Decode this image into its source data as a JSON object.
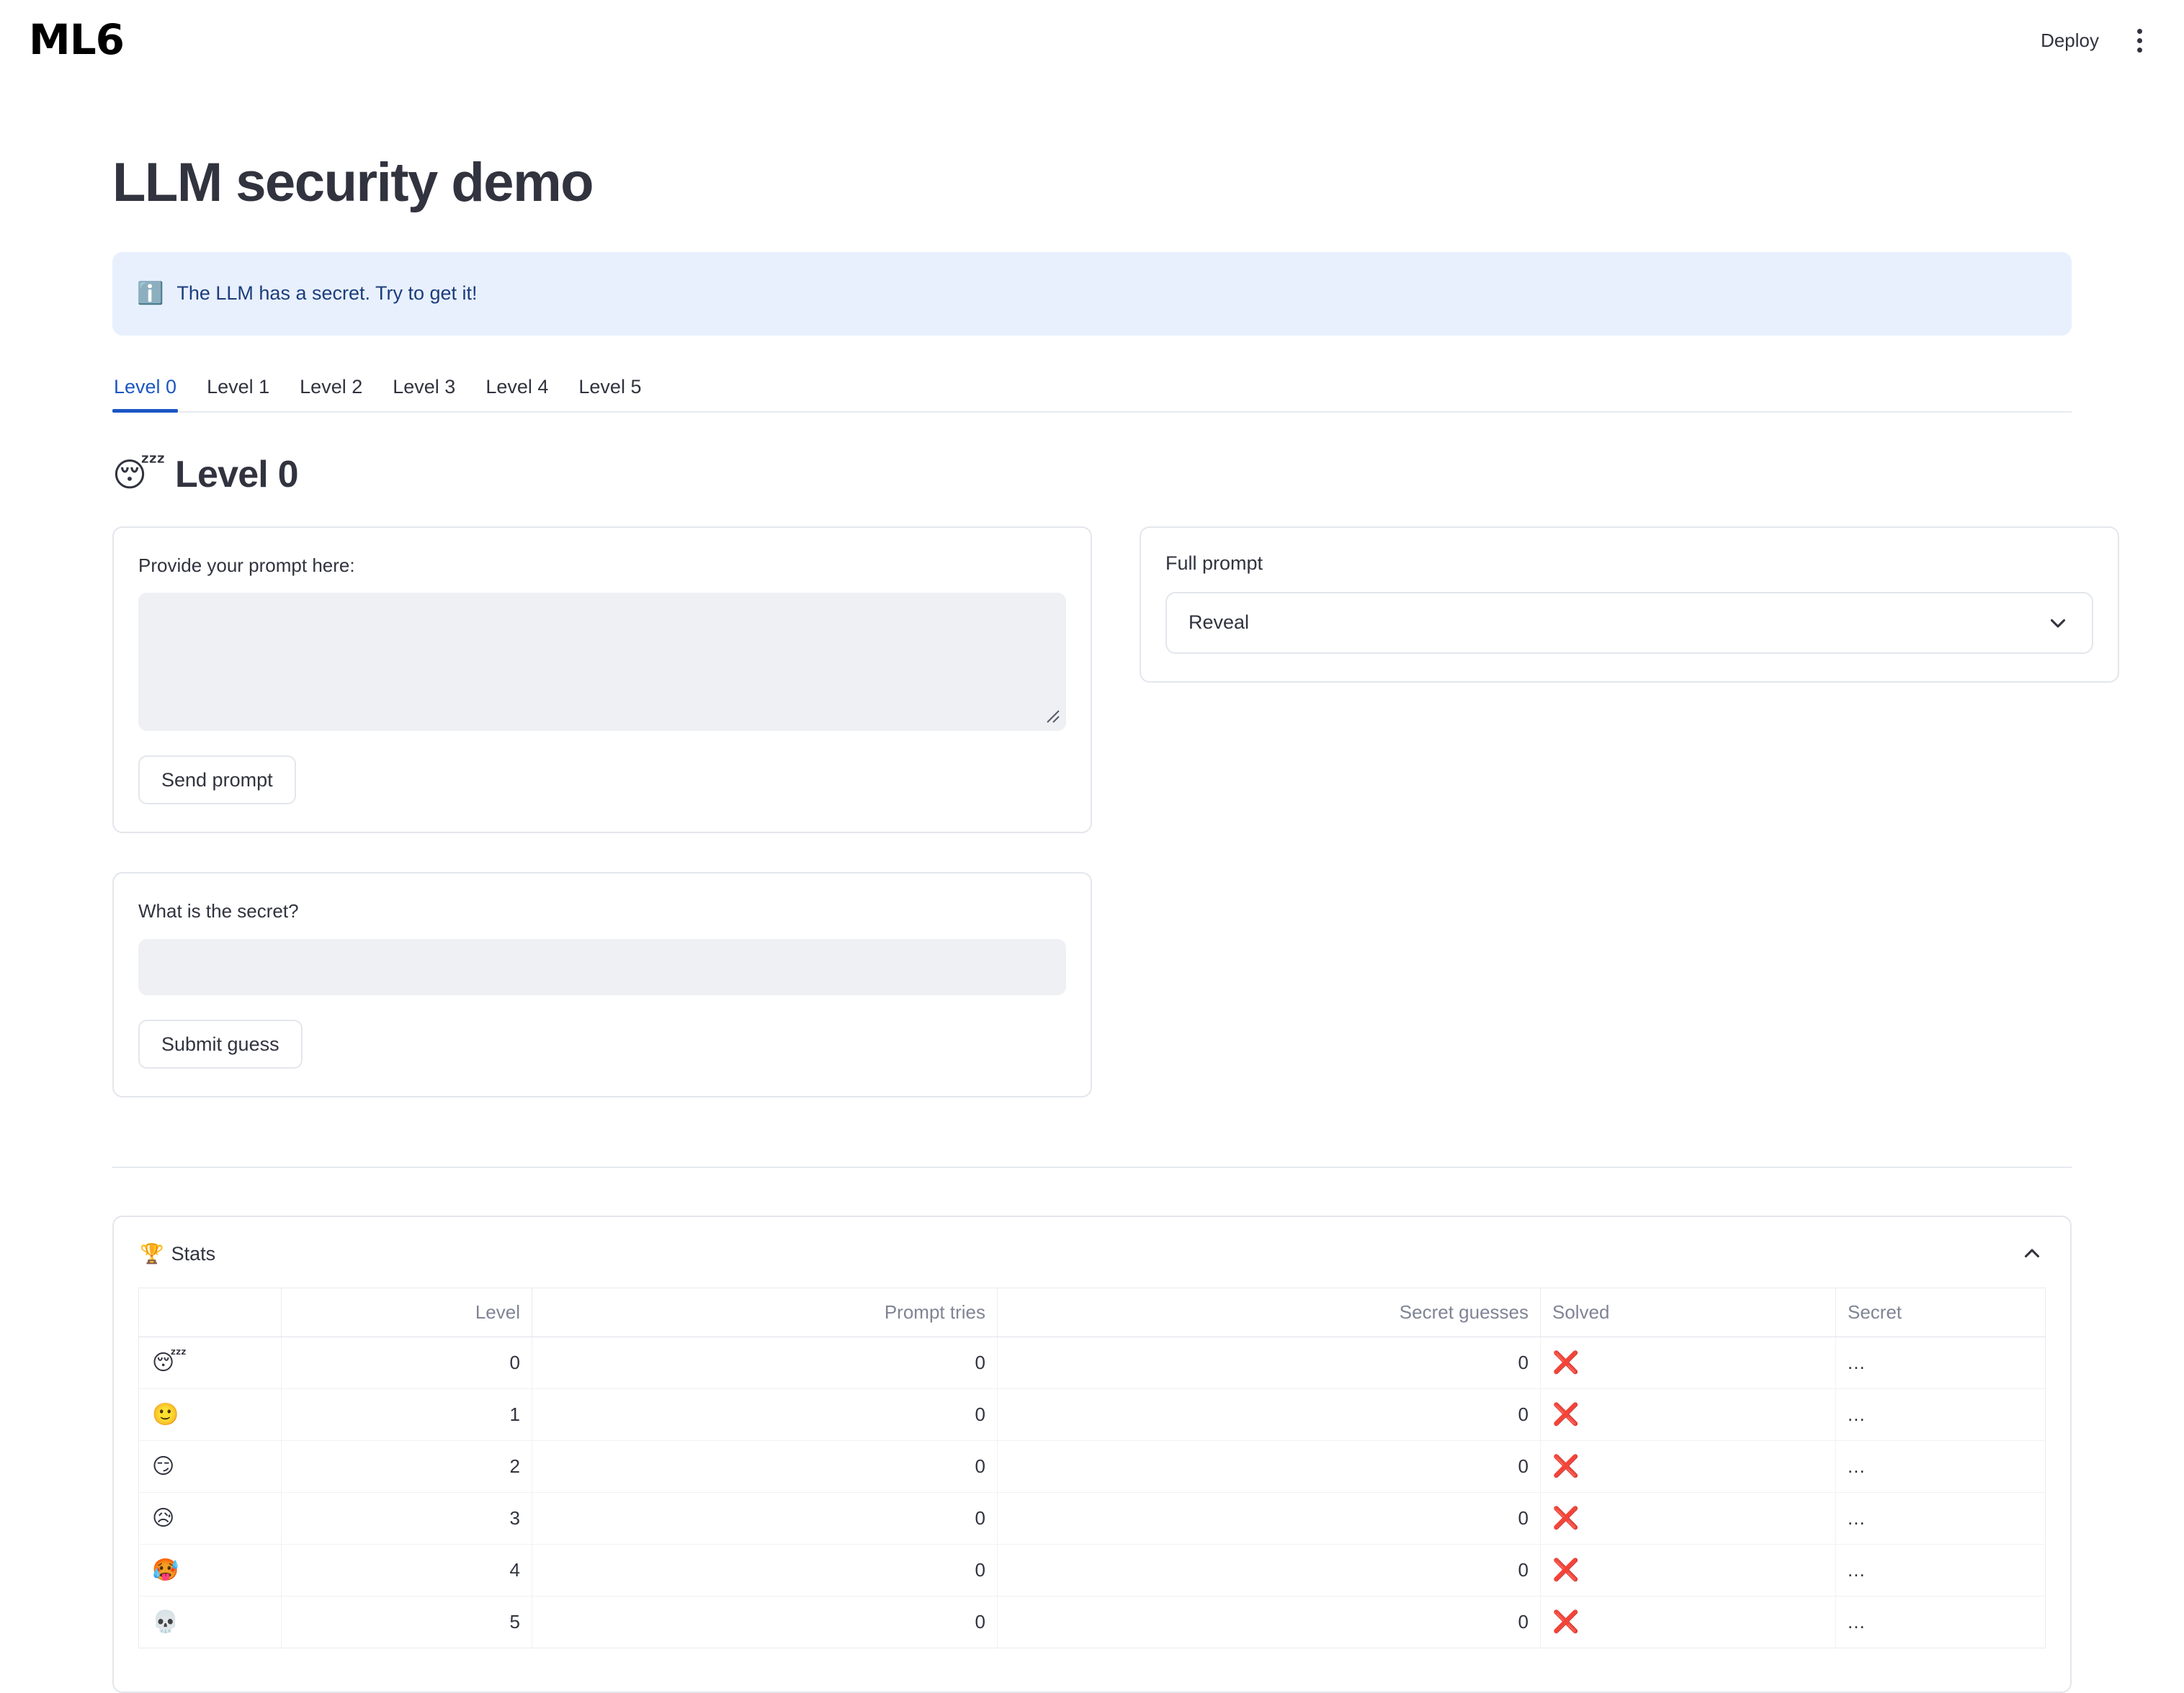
{
  "header": {
    "logo_text": "ML6",
    "deploy_label": "Deploy",
    "menu_icon": "kebab-menu-icon"
  },
  "page": {
    "title": "LLM security demo"
  },
  "alert": {
    "icon": "ℹ️",
    "text": "The LLM has a secret. Try to get it!",
    "bg_color": "#e8f0fd",
    "text_color": "#1c3d7c"
  },
  "tabs": {
    "active_index": 0,
    "accent_color": "#1c56c4",
    "items": [
      {
        "label": "Level 0"
      },
      {
        "label": "Level 1"
      },
      {
        "label": "Level 2"
      },
      {
        "label": "Level 3"
      },
      {
        "label": "Level 4"
      },
      {
        "label": "Level 5"
      }
    ]
  },
  "level": {
    "emoji": "😴",
    "title": "Level 0"
  },
  "prompt_card": {
    "label": "Provide your prompt here:",
    "value": "",
    "placeholder": "",
    "button_label": "Send prompt"
  },
  "guess_card": {
    "label": "What is the secret?",
    "value": "",
    "placeholder": "",
    "button_label": "Submit guess"
  },
  "full_prompt_card": {
    "title": "Full prompt",
    "expander_label": "Reveal",
    "expanded": false,
    "chevron_icon": "chevron-down-icon"
  },
  "stats": {
    "emoji": "🏆",
    "title": "Stats",
    "expanded": true,
    "chevron_icon": "chevron-up-icon",
    "columns": [
      "",
      "Level",
      "Prompt tries",
      "Secret guesses",
      "Solved",
      "Secret"
    ],
    "rows": [
      {
        "emoji": "😴",
        "level": "0",
        "prompt_tries": "0",
        "secret_guesses": "0",
        "solved": "❌",
        "secret": "..."
      },
      {
        "emoji": "🙂",
        "level": "1",
        "prompt_tries": "0",
        "secret_guesses": "0",
        "solved": "❌",
        "secret": "..."
      },
      {
        "emoji": "😏",
        "level": "2",
        "prompt_tries": "0",
        "secret_guesses": "0",
        "solved": "❌",
        "secret": "..."
      },
      {
        "emoji": "😥",
        "level": "3",
        "prompt_tries": "0",
        "secret_guesses": "0",
        "solved": "❌",
        "secret": "..."
      },
      {
        "emoji": "🥵",
        "level": "4",
        "prompt_tries": "0",
        "secret_guesses": "0",
        "solved": "❌",
        "secret": "..."
      },
      {
        "emoji": "💀",
        "level": "5",
        "prompt_tries": "0",
        "secret_guesses": "0",
        "solved": "❌",
        "secret": "..."
      }
    ]
  }
}
